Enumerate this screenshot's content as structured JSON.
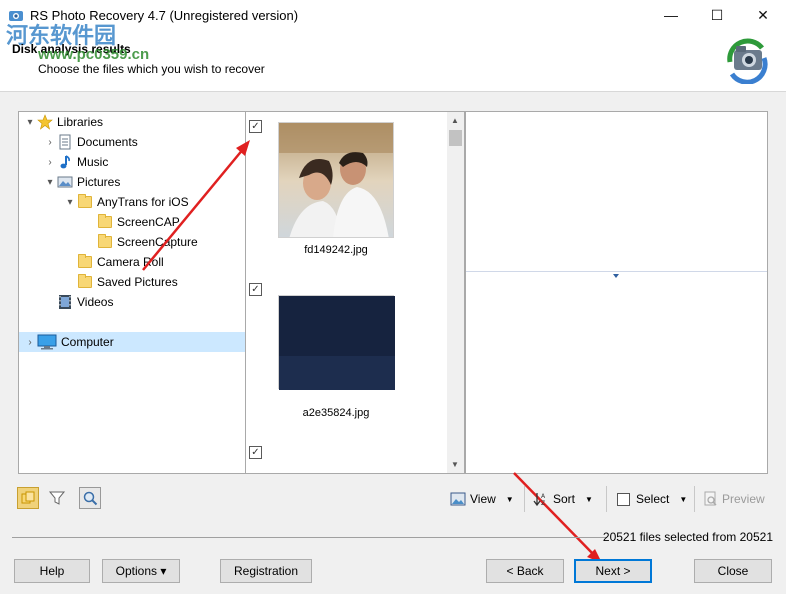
{
  "window": {
    "title": "RS Photo Recovery 4.7 (Unregistered version)",
    "minimize": "—",
    "maximize": "☐",
    "close": "✕"
  },
  "watermark": {
    "text": "河东软件园",
    "url": "www.pc0359.cn"
  },
  "header": {
    "title": "Disk analysis results",
    "subtitle": "Choose the files which you wish to recover"
  },
  "tree": {
    "items": [
      {
        "label": "Libraries",
        "icon": "star-icon"
      },
      {
        "label": "Documents",
        "icon": "documents-icon"
      },
      {
        "label": "Music",
        "icon": "music-icon"
      },
      {
        "label": "Pictures",
        "icon": "pictures-icon"
      },
      {
        "label": "AnyTrans for iOS",
        "icon": "folder-icon"
      },
      {
        "label": "ScreenCAP",
        "icon": "folder-icon"
      },
      {
        "label": "ScreenCapture",
        "icon": "folder-icon"
      },
      {
        "label": "Camera Roll",
        "icon": "folder-icon"
      },
      {
        "label": "Saved Pictures",
        "icon": "folder-icon"
      },
      {
        "label": "Videos",
        "icon": "videos-icon"
      },
      {
        "label": "Computer",
        "icon": "computer-icon"
      }
    ]
  },
  "files": [
    {
      "name": "fd149242.jpg",
      "checked": true
    },
    {
      "name": "a2e35824.jpg",
      "checked": true
    },
    {
      "name": "",
      "checked": true
    }
  ],
  "toolbar": {
    "view": "View",
    "sort": "Sort",
    "select": "Select",
    "preview": "Preview"
  },
  "status": "20521 files selected from 20521",
  "buttons": {
    "help": "Help",
    "options": "Options ▾",
    "registration": "Registration",
    "back": "< Back",
    "next": "Next >",
    "close": "Close"
  },
  "colors": {
    "accent": "#0078d7",
    "selection": "#cce8ff",
    "annotation_arrow": "#e02020"
  }
}
